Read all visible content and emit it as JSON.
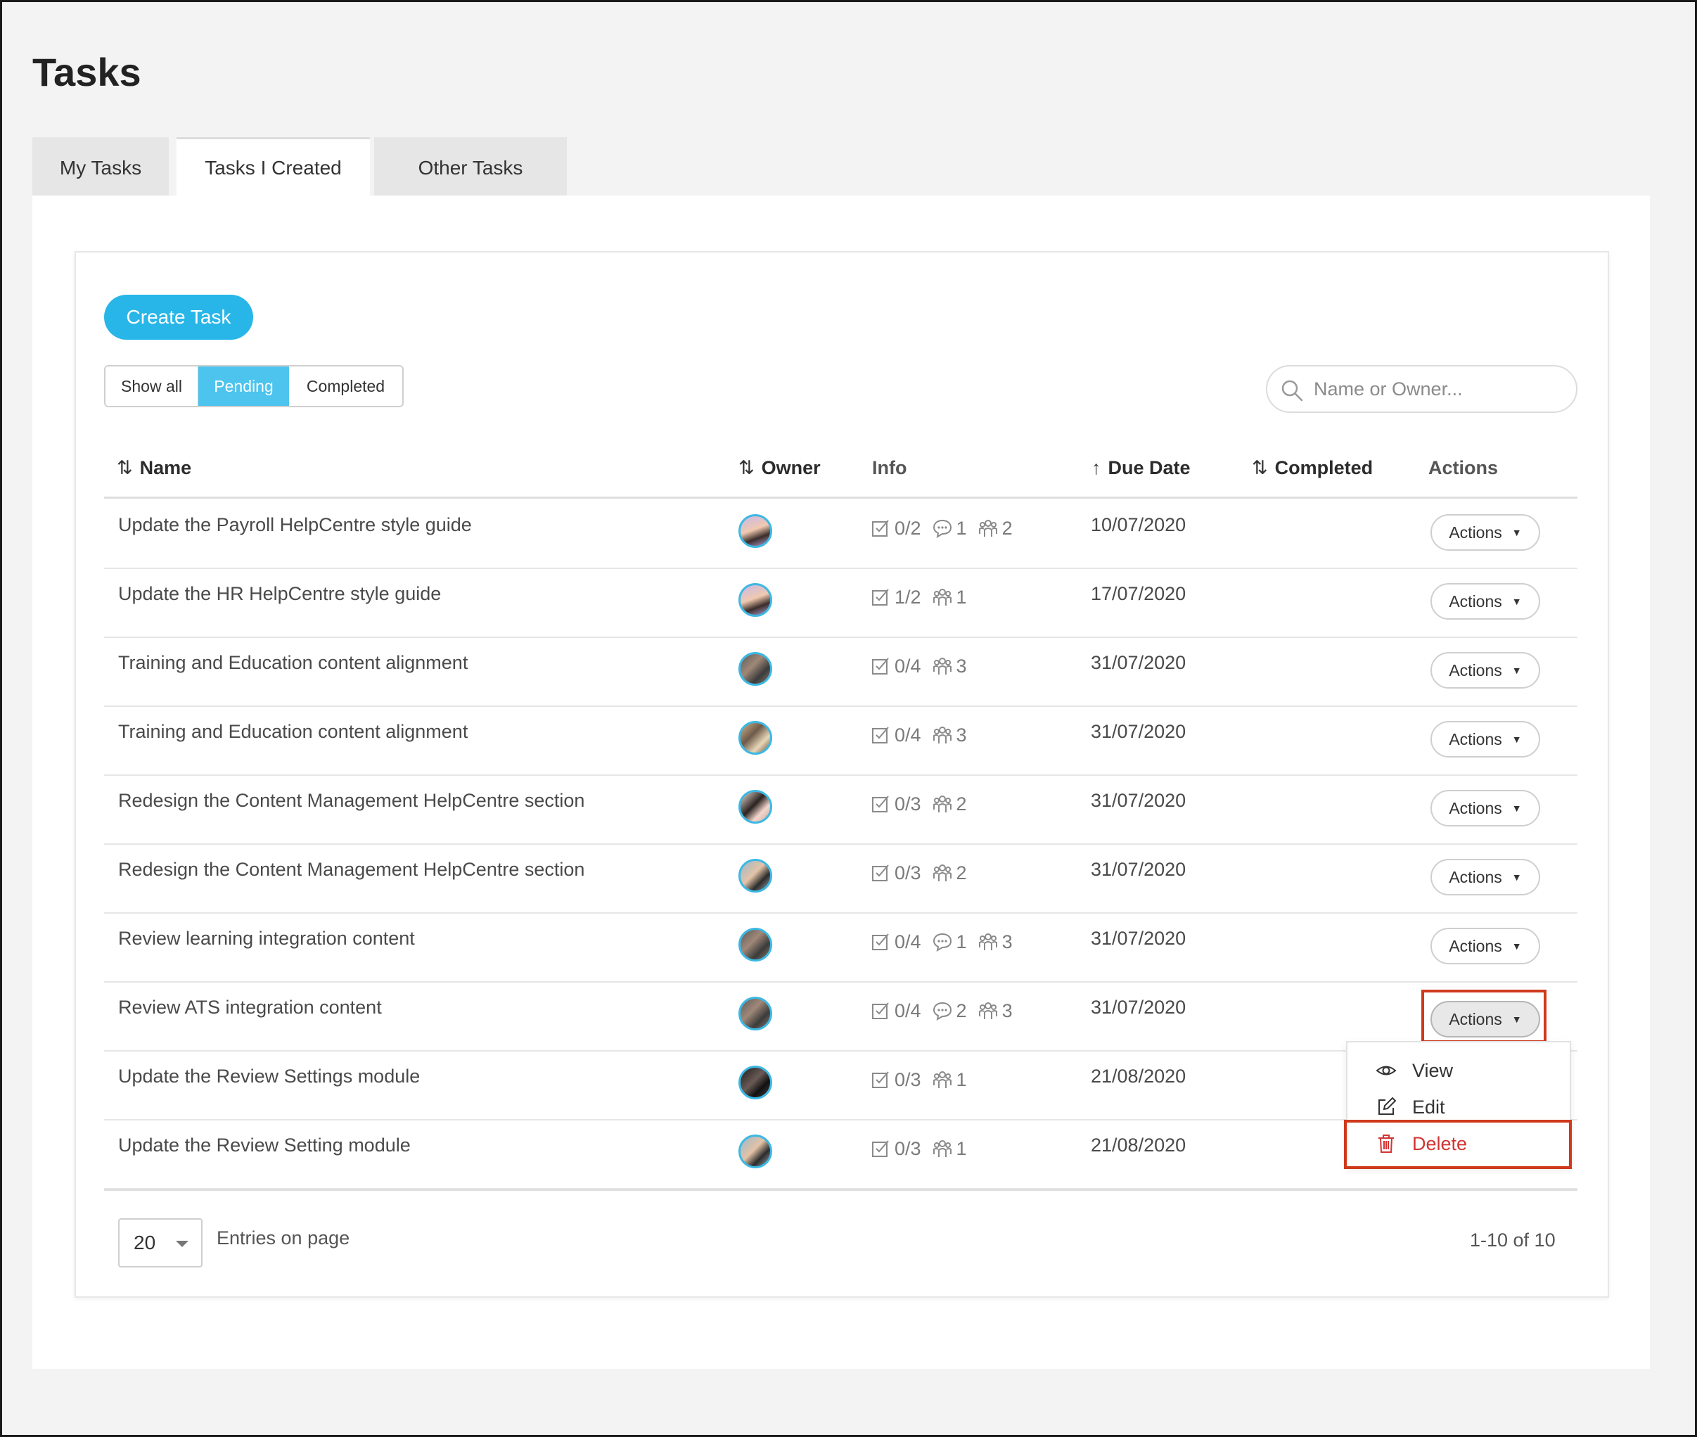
{
  "page": {
    "title": "Tasks"
  },
  "tabs": [
    {
      "label": "My Tasks",
      "active": false
    },
    {
      "label": "Tasks I Created",
      "active": true
    },
    {
      "label": "Other Tasks",
      "active": false
    }
  ],
  "toolbar": {
    "create_label": "Create Task",
    "filters": [
      "Show all",
      "Pending",
      "Completed"
    ],
    "active_filter": "Pending",
    "search_placeholder": "Name or Owner..."
  },
  "colors": {
    "accent": "#28b6e8",
    "highlight": "#cf3a1d",
    "danger": "#d23434"
  },
  "table": {
    "headers": {
      "name": "Name",
      "owner": "Owner",
      "info": "Info",
      "due": "Due Date",
      "completed": "Completed",
      "actions": "Actions"
    },
    "rows": [
      {
        "name": "Update the Payroll HelpCentre style guide",
        "checklist": "0/2",
        "comments": "1",
        "assignees": "2",
        "due": "10/07/2020",
        "action": "Actions"
      },
      {
        "name": "Update the HR HelpCentre style guide",
        "checklist": "1/2",
        "comments": null,
        "assignees": "1",
        "due": "17/07/2020",
        "action": "Actions"
      },
      {
        "name": "Training and Education content alignment",
        "checklist": "0/4",
        "comments": null,
        "assignees": "3",
        "due": "31/07/2020",
        "action": "Actions"
      },
      {
        "name": "Training and Education content alignment",
        "checklist": "0/4",
        "comments": null,
        "assignees": "3",
        "due": "31/07/2020",
        "action": "Actions"
      },
      {
        "name": "Redesign the Content Management HelpCentre section",
        "checklist": "0/3",
        "comments": null,
        "assignees": "2",
        "due": "31/07/2020",
        "action": "Actions"
      },
      {
        "name": "Redesign the Content Management HelpCentre section",
        "checklist": "0/3",
        "comments": null,
        "assignees": "2",
        "due": "31/07/2020",
        "action": "Actions"
      },
      {
        "name": "Review learning integration content",
        "checklist": "0/4",
        "comments": "1",
        "assignees": "3",
        "due": "31/07/2020",
        "action": "Actions"
      },
      {
        "name": "Review ATS integration content",
        "checklist": "0/4",
        "comments": "2",
        "assignees": "3",
        "due": "31/07/2020",
        "action": "Actions"
      },
      {
        "name": "Update the Review Settings module",
        "checklist": "0/3",
        "comments": null,
        "assignees": "1",
        "due": "21/08/2020",
        "action": null
      },
      {
        "name": "Update the Review Setting module",
        "checklist": "0/3",
        "comments": null,
        "assignees": "1",
        "due": "21/08/2020",
        "action": null
      }
    ]
  },
  "actions_menu": {
    "items": [
      "View",
      "Edit",
      "Delete"
    ]
  },
  "pagination": {
    "page_size": "20",
    "entries_label": "Entries on page",
    "range": "1-10 of 10"
  }
}
